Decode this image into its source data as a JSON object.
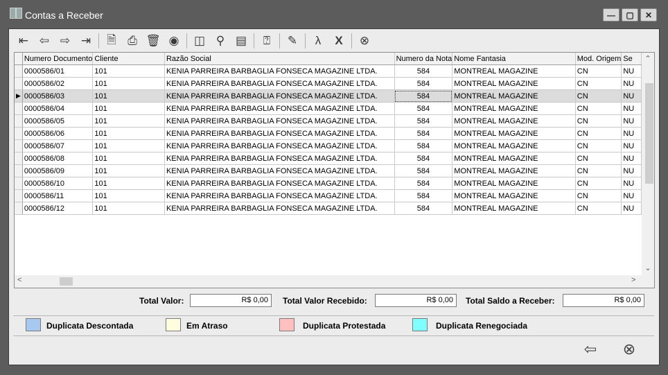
{
  "window": {
    "title": "Contas a Receber"
  },
  "grid": {
    "columns": [
      "Numero Documento",
      "Cliente",
      "Razão Social",
      "Numero da Nota",
      "Nome Fantasia",
      "Mod. Origem",
      "Se"
    ],
    "rows": [
      [
        "0000586/01",
        "101",
        "KENIA PARREIRA BARBAGLIA FONSECA MAGAZINE LTDA.",
        "584",
        "MONTREAL MAGAZINE",
        "CN",
        "NU"
      ],
      [
        "0000586/02",
        "101",
        "KENIA PARREIRA BARBAGLIA FONSECA MAGAZINE LTDA.",
        "584",
        "MONTREAL MAGAZINE",
        "CN",
        "NU"
      ],
      [
        "0000586/03",
        "101",
        "KENIA PARREIRA BARBAGLIA FONSECA MAGAZINE LTDA.",
        "584",
        "MONTREAL MAGAZINE",
        "CN",
        "NU"
      ],
      [
        "0000586/04",
        "101",
        "KENIA PARREIRA BARBAGLIA FONSECA MAGAZINE LTDA.",
        "584",
        "MONTREAL MAGAZINE",
        "CN",
        "NU"
      ],
      [
        "0000586/05",
        "101",
        "KENIA PARREIRA BARBAGLIA FONSECA MAGAZINE LTDA.",
        "584",
        "MONTREAL MAGAZINE",
        "CN",
        "NU"
      ],
      [
        "0000586/06",
        "101",
        "KENIA PARREIRA BARBAGLIA FONSECA MAGAZINE LTDA.",
        "584",
        "MONTREAL MAGAZINE",
        "CN",
        "NU"
      ],
      [
        "0000586/07",
        "101",
        "KENIA PARREIRA BARBAGLIA FONSECA MAGAZINE LTDA.",
        "584",
        "MONTREAL MAGAZINE",
        "CN",
        "NU"
      ],
      [
        "0000586/08",
        "101",
        "KENIA PARREIRA BARBAGLIA FONSECA MAGAZINE LTDA.",
        "584",
        "MONTREAL MAGAZINE",
        "CN",
        "NU"
      ],
      [
        "0000586/09",
        "101",
        "KENIA PARREIRA BARBAGLIA FONSECA MAGAZINE LTDA.",
        "584",
        "MONTREAL MAGAZINE",
        "CN",
        "NU"
      ],
      [
        "0000586/10",
        "101",
        "KENIA PARREIRA BARBAGLIA FONSECA MAGAZINE LTDA.",
        "584",
        "MONTREAL MAGAZINE",
        "CN",
        "NU"
      ],
      [
        "0000586/11",
        "101",
        "KENIA PARREIRA BARBAGLIA FONSECA MAGAZINE LTDA.",
        "584",
        "MONTREAL MAGAZINE",
        "CN",
        "NU"
      ],
      [
        "0000586/12",
        "101",
        "KENIA PARREIRA BARBAGLIA FONSECA MAGAZINE LTDA.",
        "584",
        "MONTREAL MAGAZINE",
        "CN",
        "NU"
      ]
    ],
    "selected_row": 2
  },
  "totals": {
    "valor_label": "Total Valor:",
    "valor": "R$ 0,00",
    "recebido_label": "Total Valor Recebido:",
    "recebido": "R$ 0,00",
    "saldo_label": "Total Saldo a Receber:",
    "saldo": "R$ 0,00"
  },
  "legend": [
    {
      "label": "Duplicata Descontada",
      "color": "#a8c8f0"
    },
    {
      "label": "Em Atraso",
      "color": "#fffde0"
    },
    {
      "label": "Duplicata Protestada",
      "color": "#ffc0c0"
    },
    {
      "label": "Duplicata Renegociada",
      "color": "#80ffff"
    }
  ],
  "toolbar_icons": [
    "first-record-icon",
    "previous-record-icon",
    "next-record-icon",
    "last-record-icon",
    "new-document-icon",
    "print-icon",
    "delete-icon",
    "view-icon",
    "clear-icon",
    "search-icon",
    "report-icon",
    "help-icon",
    "edit-icon",
    "pdf-icon",
    "excel-icon",
    "close-circle-icon"
  ]
}
